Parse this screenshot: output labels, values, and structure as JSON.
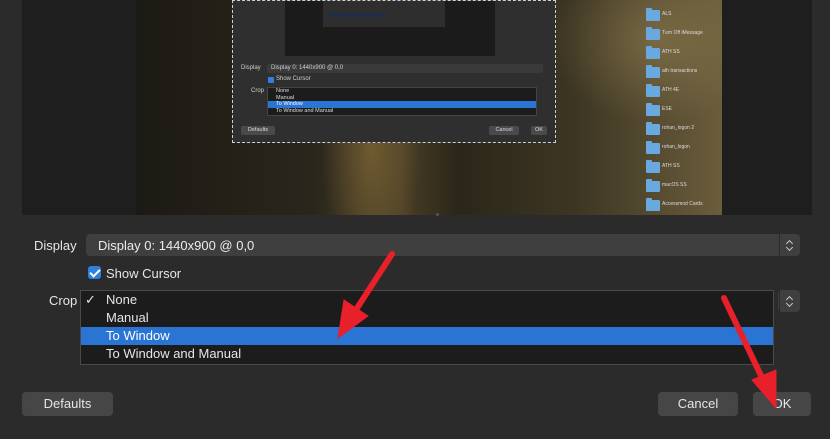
{
  "preview": {
    "mini_dialog": {
      "display_label": "Display",
      "display_value": "Display 0: 1440x900 @ 0,0",
      "show_cursor_label": "Show Cursor",
      "crop_label": "Crop",
      "crop_options": [
        "None",
        "Manual",
        "To Window",
        "To Window and Manual"
      ],
      "selected_index": 2,
      "defaults_label": "Defaults",
      "cancel_label": "Cancel",
      "ok_label": "OK"
    },
    "desktop_items": [
      "ALS",
      "Turn Off iMessage",
      "ATH SS",
      "ath transactions",
      "ATH 4E",
      "ESE",
      "rohan_logon 2",
      "rohan_logon",
      "ATH SS",
      "macOS SS",
      "Accessmod Cards"
    ]
  },
  "properties": {
    "display_label": "Display",
    "display_value": "Display 0: 1440x900 @ 0,0",
    "show_cursor_label": "Show Cursor",
    "show_cursor_checked": true,
    "crop_label": "Crop",
    "crop_options": [
      {
        "label": "None",
        "checked": true,
        "selected": false
      },
      {
        "label": "Manual",
        "checked": false,
        "selected": false
      },
      {
        "label": "To Window",
        "checked": false,
        "selected": true
      },
      {
        "label": "To Window and Manual",
        "checked": false,
        "selected": false
      }
    ]
  },
  "buttons": {
    "defaults": "Defaults",
    "cancel": "Cancel",
    "ok": "OK"
  },
  "colors": {
    "background": "#2b2b2b",
    "selection": "#2a74d4",
    "annotation_arrow": "#e8202a"
  }
}
